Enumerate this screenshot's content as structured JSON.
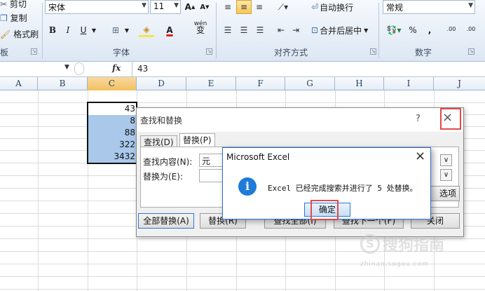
{
  "ribbon": {
    "clipboard": {
      "cut": "剪切",
      "copy": "复制",
      "format_painter": "格式刷",
      "group_label": "板"
    },
    "font": {
      "name": "宋体",
      "size": "11",
      "grow_font": "A",
      "shrink_font": "A",
      "bold": "B",
      "italic": "I",
      "underline": "U",
      "phonetic": "wén",
      "font_color_letter": "A",
      "group_label": "字体"
    },
    "alignment": {
      "wrap_text": "自动换行",
      "merge_center": "合并后居中",
      "group_label": "对齐方式"
    },
    "number": {
      "format": "常规",
      "percent": "%",
      "comma": ",",
      "inc_decimal": ".00",
      "dec_decimal": ".00",
      "group_label": "数字"
    }
  },
  "formula_bar": {
    "fx": "fx",
    "value": "43"
  },
  "grid": {
    "columns": [
      "A",
      "B",
      "C",
      "D",
      "E",
      "F",
      "G",
      "H",
      "I",
      "J"
    ],
    "selected_column": "C",
    "cells": [
      "43",
      "8",
      "88",
      "322",
      "3432"
    ]
  },
  "find_replace_dialog": {
    "title": "查找和替换",
    "help": "?",
    "close": "×",
    "tab_find": "查找(D)",
    "tab_replace": "替换(P)",
    "find_label": "查找内容(N):",
    "find_value": "元",
    "replace_label": "替换为(E):",
    "replace_value": "",
    "options_button": "选项(T) >>",
    "replace_all": "全部替换(A)",
    "replace": "替换(R)",
    "find_all": "查找全部(I)",
    "find_next": "查找下一个(F)",
    "close_button": "关闭"
  },
  "message_box": {
    "title": "Microsoft Excel",
    "close": "×",
    "info_icon": "i",
    "message": "Excel 已经完成搜索并进行了 5 处替换。",
    "ok": "确定"
  },
  "watermark": {
    "text": "搜狗指南",
    "url": "zhinan.sogou.com"
  },
  "colors": {
    "accent_highlight": "#e24a4a",
    "selection_fill": "#a9c8ea",
    "info_icon": "#1e7bd8"
  }
}
